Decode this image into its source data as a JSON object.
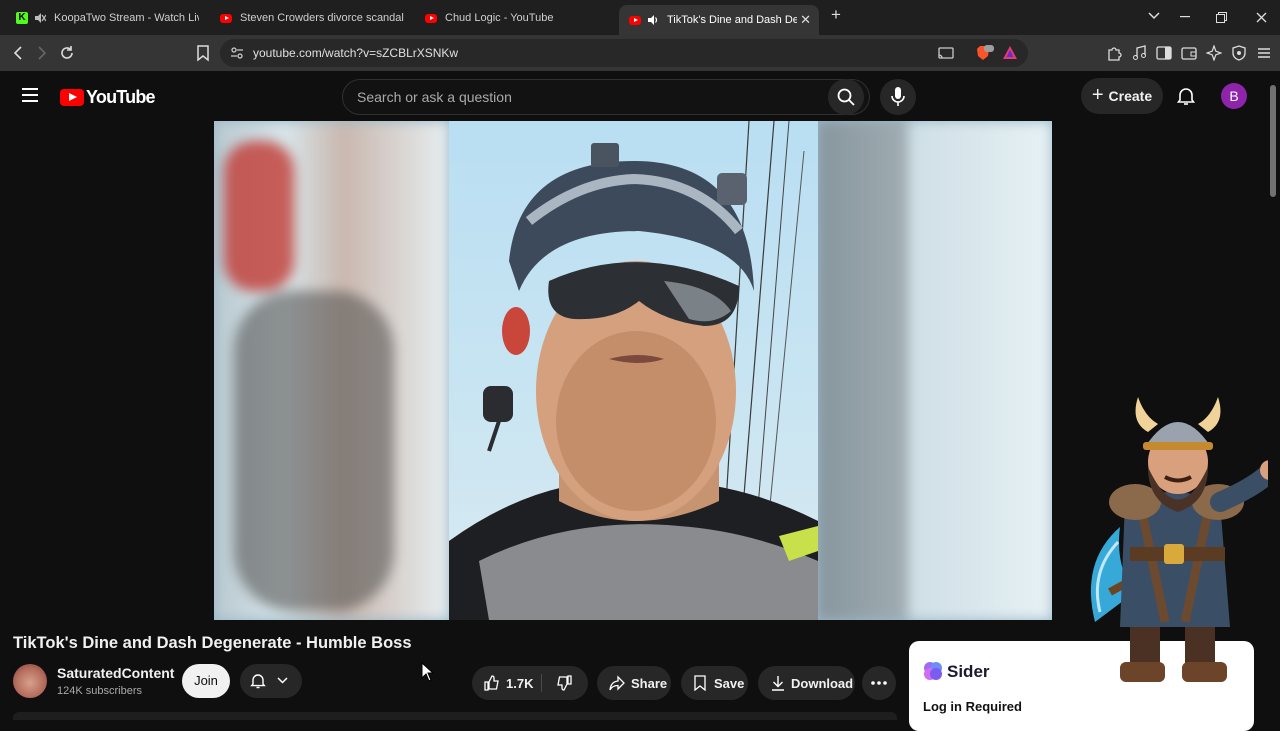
{
  "browser": {
    "tabs": [
      {
        "title": "KoopaTwo Stream - Watch Live o",
        "favicon": "kick-icon",
        "active": false
      },
      {
        "title": "Steven Crowders divorce scandal | RE",
        "favicon": "youtube-icon",
        "active": false
      },
      {
        "title": "Chud Logic - YouTube",
        "favicon": "youtube-icon",
        "active": false
      },
      {
        "title": "TikTok's Dine and Dash Deger",
        "favicon": "youtube-icon",
        "active": true
      }
    ],
    "url": "youtube.com/watch?v=sZCBLrXSNKw",
    "new_tab_label": "+"
  },
  "youtube": {
    "logo_text": "YouTube",
    "search_placeholder": "Search or ask a question",
    "create_label": "Create",
    "avatar_letter": "B"
  },
  "video": {
    "title": "TikTok's Dine and Dash Degenerate - Humble Boss",
    "channel_name": "SaturatedContent",
    "subscribers": "124K subscribers",
    "join_label": "Join",
    "likes": "1.7K",
    "share_label": "Share",
    "save_label": "Save",
    "download_label": "Download"
  },
  "sider": {
    "name": "Sider",
    "status": "Log in Required"
  },
  "colors": {
    "yt_red": "#ff0000",
    "avatar_purple": "#8e24aa",
    "background": "#0f0f0f",
    "chip": "#272727"
  }
}
